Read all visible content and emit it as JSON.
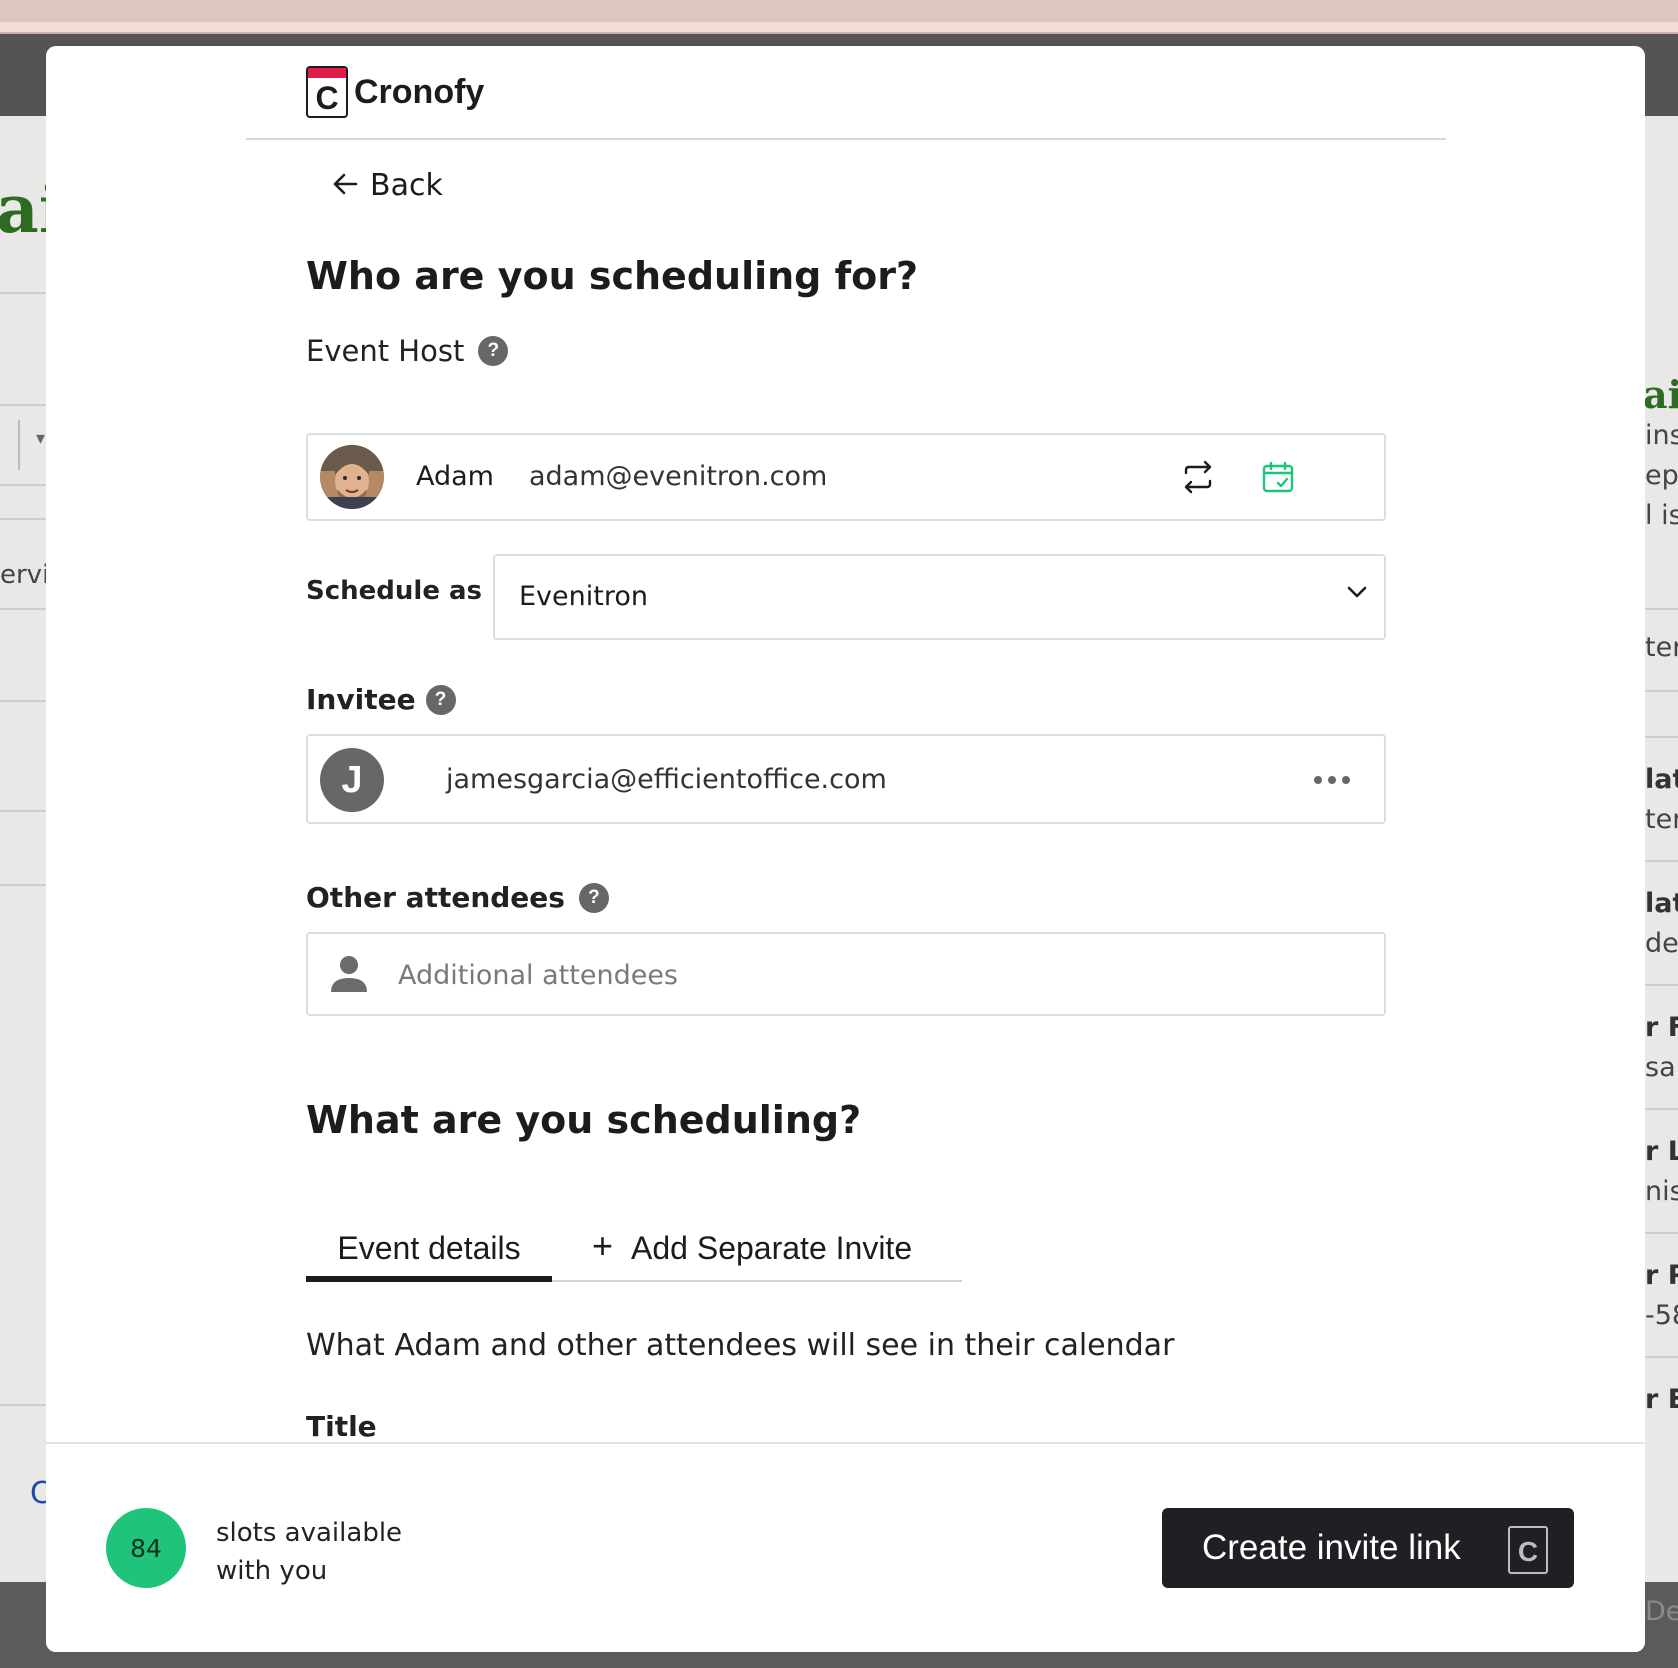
{
  "background": {
    "left_title": "ail",
    "left_text": "ervie",
    "left_link": "C",
    "right_title": "ai",
    "right_lines": [
      "ins",
      "epla",
      "l is",
      "ter",
      "lat",
      "ter",
      "lat",
      "de",
      "r Fi",
      "sa",
      "r La",
      "niso",
      "r P",
      "-58",
      "r E",
      "Des"
    ]
  },
  "brand": {
    "name": "Cronofy",
    "logo_letter": "C",
    "accent_color": "#e11d48"
  },
  "nav": {
    "back_label": "Back"
  },
  "who": {
    "heading": "Who are you scheduling for?",
    "event_host_label": "Event Host",
    "host": {
      "name": "Adam",
      "email": "adam@evenitron.com"
    },
    "schedule_as_label": "Schedule as",
    "schedule_as_value": "Evenitron",
    "invitee_label": "Invitee",
    "invitee": {
      "initial": "J",
      "email": "jamesgarcia@efficientoffice.com"
    },
    "other_attendees_label": "Other attendees",
    "other_attendees_placeholder": "Additional attendees"
  },
  "what": {
    "heading": "What are you scheduling?",
    "tabs": [
      {
        "label": "Event details",
        "active": true
      },
      {
        "label": "Add Separate Invite",
        "icon": "plus-icon"
      }
    ],
    "description": "What Adam and other attendees will see in their calendar",
    "title_label": "Title"
  },
  "footer": {
    "slots_count": "84",
    "slots_line1": "slots available",
    "slots_line2": "with you",
    "cta_label": "Create invite link",
    "badge_color": "#1fc47a"
  },
  "icons": {
    "help": "question-circle-icon",
    "switch": "swap-arrows-icon",
    "calendar": "calendar-check-icon",
    "dropdown": "chevron-down-icon",
    "more": "more-horizontal-icon",
    "person": "person-icon"
  }
}
